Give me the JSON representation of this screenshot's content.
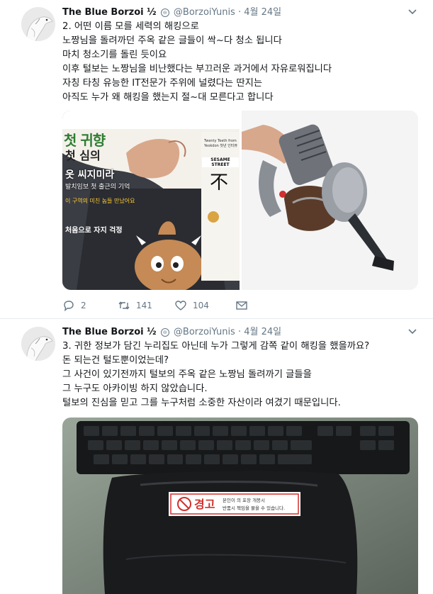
{
  "tweet1": {
    "author": "The Blue Borzoi ½",
    "handle": "@BorzoiYunis",
    "separator": "·",
    "date": "4월 24일",
    "lines": [
      "2. 어떤 이름 모를 세력의 해킹으로",
      "노짱님을 돌려까던 주옥 같은 글들이 싹~다 청소 됩니다",
      "마치 청소기를 돌린 듯이요",
      "이후 털보는 노짱님을 비난했다는 부끄러운 과거에서 자유로워집니다",
      "자칭 타칭 유능한 IT전문가 주위에 널렸다는 딴지는",
      "아직도 누가 왜 해킹을 했는지 절~대 모른다고 합니다"
    ],
    "magazine": {
      "title": "첫 귀향",
      "headline1": "첫 심의",
      "headline2": "옷 씨지미라",
      "sub1": "발치임보 첫 출근의 기억",
      "sub2": "이 구역의 미친 놈들 만났어요",
      "sub3": "처음으로 자지 걱정",
      "brand": "SESAME STREET",
      "side_text": "Twenty Teeth from Yeokdon 첫년 인터뷰",
      "vertical": "不"
    },
    "replies": "2",
    "retweets": "141",
    "likes": "104"
  },
  "tweet2": {
    "author": "The Blue Borzoi ½",
    "handle": "@BorzoiYunis",
    "separator": "·",
    "date": "4월 24일",
    "lines": [
      "3. 귀한 정보가 담긴 누리집도 아닌데 누가 그렇게 감쪽 같이 해킹을 했을까요?",
      "돈 되는건 털도뿐이었는데?",
      "그 사건이 있기전까지 털보의 주옥 같은 노짱님 돌려까기 글들을",
      "그 누구도 아카이빙 하지 않았습니다.",
      "털보의 진심을 믿고 그를 누구처럼 소중한 자산이라 여겼기 때문입니다."
    ],
    "warning_label": "경고",
    "warning_text1": "본인이 의 포장 개봉시",
    "warning_text2": "반품시 책임을 물을 수 있습니다."
  }
}
